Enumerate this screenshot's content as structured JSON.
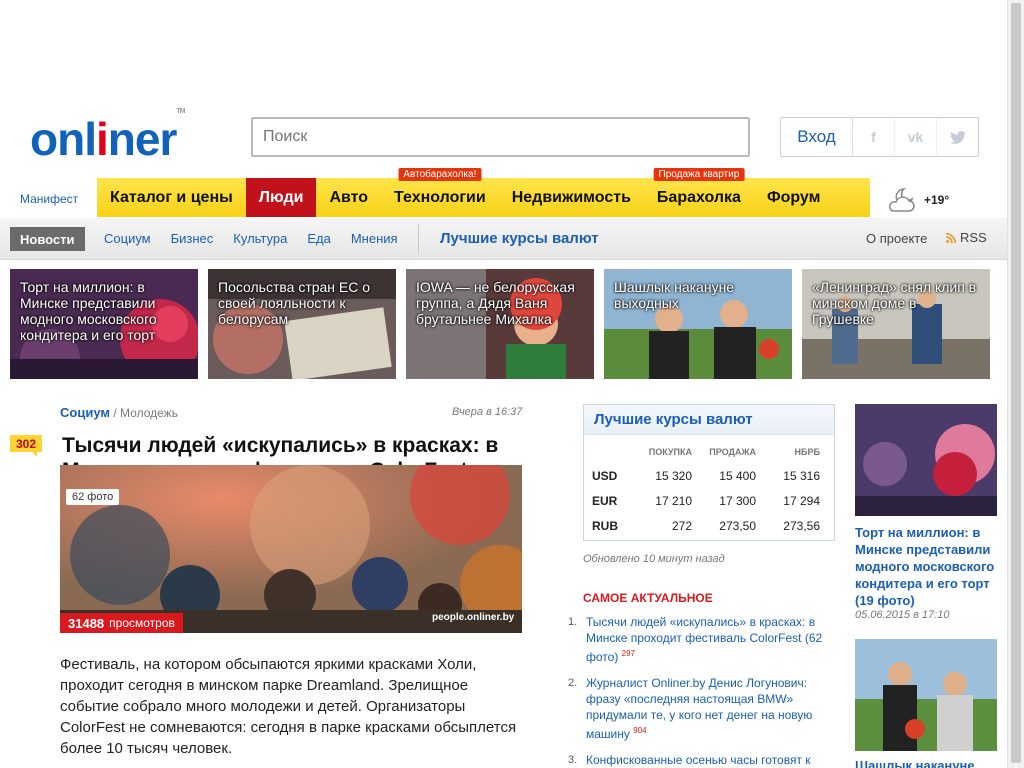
{
  "header": {
    "logo_text": "onliner",
    "search_placeholder": "Поиск",
    "login_label": "Вход",
    "social": [
      "f",
      "vk",
      "t"
    ]
  },
  "nav": {
    "manifest": "Манифест",
    "items": [
      {
        "label": "Каталог и цены",
        "tag": ""
      },
      {
        "label": "Люди",
        "tag": "",
        "active": true
      },
      {
        "label": "Авто",
        "tag": ""
      },
      {
        "label": "Технологии",
        "tag": "Автобарахолка!"
      },
      {
        "label": "Недвижимость",
        "tag": ""
      },
      {
        "label": "Барахолка",
        "tag": "Продажа квартир"
      },
      {
        "label": "Форум",
        "tag": ""
      }
    ],
    "weather": "+19°"
  },
  "subnav": {
    "active": "Новости",
    "categories": [
      "Социум",
      "Бизнес",
      "Культура",
      "Еда",
      "Мнения"
    ],
    "rates_link": "Лучшие курсы валют",
    "about": "О проекте",
    "rss": "RSS"
  },
  "tiles": [
    {
      "caption": "Торт на миллион: в Минске представили модного московского кондитера и его торт"
    },
    {
      "caption": "Посольства стран ЕС о своей лояльности к белорусам"
    },
    {
      "caption": "IOWA — не белорусская группа, а Дядя Ваня брутальнее Михалка"
    },
    {
      "caption": "Шашлык накануне выходных"
    },
    {
      "caption": "«Ленинград» снял клип в минском доме в Грушевке"
    }
  ],
  "article": {
    "category": "Социум",
    "subcategory": "Молодежь",
    "time": "Вчера в 16:37",
    "comments": "302",
    "title": "Тысячи людей «искупались» в красках: в Минске проходит фестиваль ColorFest",
    "photo_count": "62 фото",
    "views_count": "31488",
    "views_label": "просмотров",
    "watermark": "people.onliner.by",
    "text": "Фестиваль, на котором обсыпаются яркими красками Холи, проходит сегодня в минском парке Dreamland. Зрелищное событие собрало много молодежи и детей. Организаторы ColorFest не сомневаются: сегодня в парке красками обсыплется более 10 тысяч человек."
  },
  "rates": {
    "title": "Лучшие курсы валют",
    "columns": [
      "ПОКУПКА",
      "ПРОДАЖА",
      "НБРБ"
    ],
    "rows": [
      {
        "currency": "USD",
        "buy": "15 320",
        "sell": "15 400",
        "nbrb": "15 316"
      },
      {
        "currency": "EUR",
        "buy": "17 210",
        "sell": "17 300",
        "nbrb": "17 294"
      },
      {
        "currency": "RUB",
        "buy": "272",
        "sell": "273,50",
        "nbrb": "273,56"
      }
    ],
    "updated": "Обновлено 10 минут назад"
  },
  "top": {
    "heading": "САМОЕ АКТУАЛЬНОЕ",
    "items": [
      {
        "n": "1.",
        "text": "Тысячи людей «искупались» в красках: в Минске проходит фестиваль ColorFest (62 фото)",
        "count": "297"
      },
      {
        "n": "2.",
        "text": "Журналист Onliner.by Денис Логунович: фразу «последняя настоящая BMW» придумали те, у кого нет денег на новую машину",
        "count": "904"
      },
      {
        "n": "3.",
        "text": "Конфискованные осенью часы готовят к продаже — на ценниках не хватает места",
        "count": ""
      }
    ]
  },
  "right": [
    {
      "title": "Торт на миллион: в Минске представили модного московского кондитера и его торт (19 фото)",
      "time": "05.06.2015 в 17:10"
    },
    {
      "title": "Шашлык накануне",
      "time": ""
    }
  ],
  "colors": {
    "brand": "#1063b8",
    "accent": "#d8191d",
    "nav": "#f8d117"
  }
}
